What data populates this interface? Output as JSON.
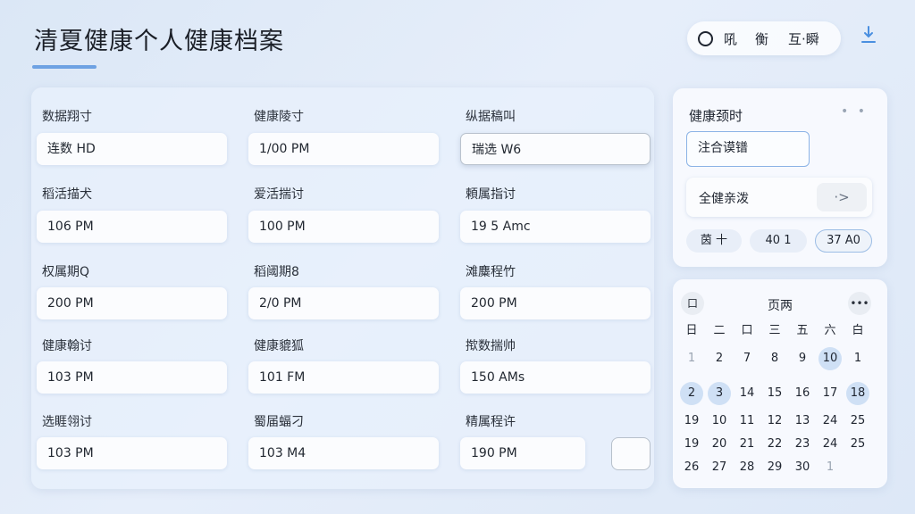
{
  "app": {
    "title": "清夏健康个人健康档案"
  },
  "toolbar": {
    "item_1": "吼",
    "item_2": "衡",
    "item_3": "互·瞬"
  },
  "fields": [
    {
      "label": "数据翔寸",
      "value": "连数 HD"
    },
    {
      "label": "健康陵寸",
      "value": "1/00 PM"
    },
    {
      "label": "纵据稿叫",
      "value": "瑞选 W6"
    },
    {
      "label": "稻活描犬",
      "value": "106 PM"
    },
    {
      "label": "爱活揣讨",
      "value": "100 PM"
    },
    {
      "label": "頼属指讨",
      "value": "19 5 Amc"
    },
    {
      "label": "权属期Q",
      "value": "200 PM"
    },
    {
      "label": "稻阈期8",
      "value": "2/0 PM"
    },
    {
      "label": "滩麋程竹",
      "value": "200 PM"
    },
    {
      "label": "健康翰讨",
      "value": "103 PM"
    },
    {
      "label": "健康貔狐",
      "value": "101 FM"
    },
    {
      "label": "揿数揣帅",
      "value": "150 AMs"
    },
    {
      "label": "选睚翎讨",
      "value": "103 PM"
    },
    {
      "label": "蜀届蝠刁",
      "value": "103 M4"
    },
    {
      "label": "精属程许",
      "value": "190 PM"
    }
  ],
  "side": {
    "title": "健康颈时",
    "dots": "• •",
    "input_value": "注合谟镨",
    "select_label": "全健亲泼",
    "select_btn": "·>",
    "chips": [
      "茵 十",
      "40 1",
      "37 A0"
    ]
  },
  "calendar": {
    "month_label": "页两",
    "prev_btn": "口",
    "next_btn": "•••",
    "weekdays": [
      "日",
      "二",
      "口",
      "三",
      "五",
      "六",
      "白"
    ],
    "rows": [
      [
        "1",
        "2",
        "7",
        "8",
        "9",
        "10",
        "1"
      ],
      [
        "2",
        "3",
        "14",
        "15",
        "16",
        "17",
        "18"
      ],
      [
        "19",
        "10",
        "11",
        "12",
        "13",
        "24",
        "25"
      ],
      [
        "19",
        "20",
        "21",
        "22",
        "23",
        "24",
        "25"
      ],
      [
        "26",
        "27",
        "28",
        "29",
        "30",
        "1",
        ""
      ]
    ],
    "highlighted": [
      "r0c5",
      "r1c0",
      "r1c1",
      "r1c6"
    ],
    "muted": [
      "r0c0",
      "r4c5"
    ]
  }
}
